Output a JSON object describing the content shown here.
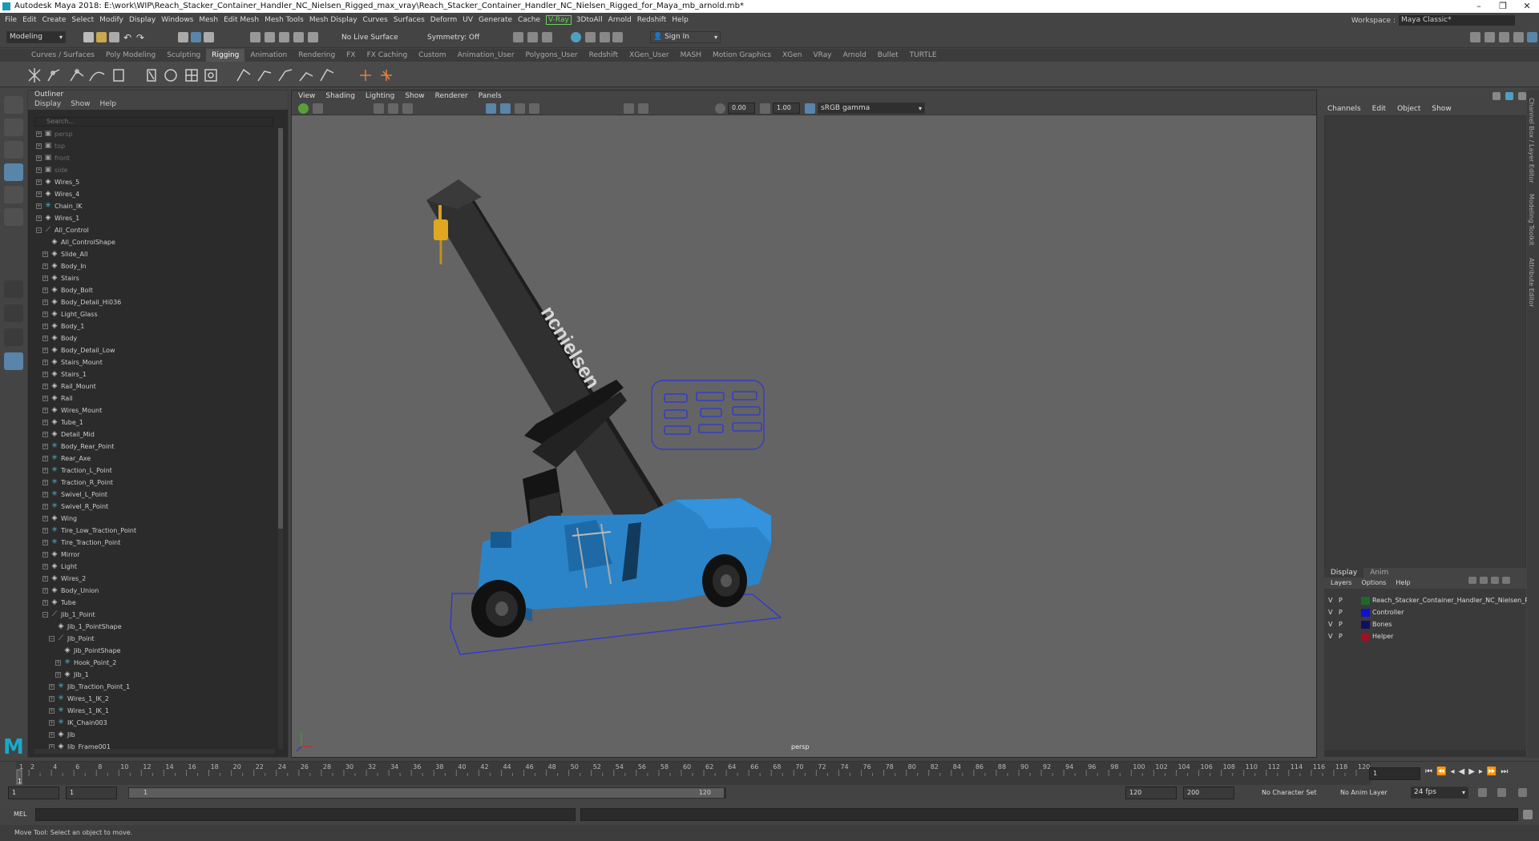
{
  "window": {
    "title": "Autodesk Maya 2018: E:\\work\\WIP\\Reach_Stacker_Container_Handler_NC_Nielsen_Rigged_max_vray\\Reach_Stacker_Container_Handler_NC_Nielsen_Rigged_for_Maya_mb_arnold.mb*",
    "controls": [
      "–",
      "❐",
      "✕"
    ]
  },
  "menubar": {
    "items": [
      "File",
      "Edit",
      "Create",
      "Select",
      "Modify",
      "Display",
      "Windows",
      "Mesh",
      "Edit Mesh",
      "Mesh Tools",
      "Mesh Display",
      "Curves",
      "Surfaces",
      "Deform",
      "UV",
      "Generate",
      "Cache"
    ],
    "vray": "V-Ray",
    "items2": [
      "3DtoAll",
      "Arnold",
      "Redshift",
      "Help"
    ],
    "workspace_label": "Workspace :",
    "workspace_value": "Maya Classic*"
  },
  "statusline": {
    "mode": "Modeling",
    "live_surface": "No Live Surface",
    "symmetry": "Symmetry: Off",
    "sign_in": "Sign In"
  },
  "shelf": {
    "tabs": [
      "Curves / Surfaces",
      "Poly Modeling",
      "Sculpting",
      "Rigging",
      "Animation",
      "Rendering",
      "FX",
      "FX Caching",
      "Custom",
      "Animation_User",
      "Polygons_User",
      "Redshift",
      "XGen_User",
      "MASH",
      "Motion Graphics",
      "XGen",
      "VRay",
      "Arnold",
      "Bullet",
      "TURTLE"
    ],
    "active": "Rigging"
  },
  "outliner": {
    "title": "Outliner",
    "menu": [
      "Display",
      "Show",
      "Help"
    ],
    "search_placeholder": "Search...",
    "items": [
      {
        "label": "persp",
        "depth": 0,
        "type": "cam",
        "dim": true
      },
      {
        "label": "top",
        "depth": 0,
        "type": "cam",
        "dim": true
      },
      {
        "label": "front",
        "depth": 0,
        "type": "cam",
        "dim": true
      },
      {
        "label": "side",
        "depth": 0,
        "type": "cam",
        "dim": true
      },
      {
        "label": "Wires_5",
        "depth": 0,
        "type": "group"
      },
      {
        "label": "Wires_4",
        "depth": 0,
        "type": "group"
      },
      {
        "label": "Chain_IK",
        "depth": 0,
        "type": "joint"
      },
      {
        "label": "Wires_1",
        "depth": 0,
        "type": "group"
      },
      {
        "label": "All_Control",
        "depth": 0,
        "type": "curve",
        "open": true
      },
      {
        "label": "All_ControlShape",
        "depth": 1,
        "type": "shape"
      },
      {
        "label": "Slide_All",
        "depth": 1,
        "type": "group"
      },
      {
        "label": "Body_In",
        "depth": 1,
        "type": "group"
      },
      {
        "label": "Stairs",
        "depth": 1,
        "type": "group"
      },
      {
        "label": "Body_Bolt",
        "depth": 1,
        "type": "group"
      },
      {
        "label": "Body_Detail_Hi036",
        "depth": 1,
        "type": "group"
      },
      {
        "label": "Light_Glass",
        "depth": 1,
        "type": "group"
      },
      {
        "label": "Body_1",
        "depth": 1,
        "type": "group"
      },
      {
        "label": "Body",
        "depth": 1,
        "type": "group"
      },
      {
        "label": "Body_Detail_Low",
        "depth": 1,
        "type": "group"
      },
      {
        "label": "Stairs_Mount",
        "depth": 1,
        "type": "group"
      },
      {
        "label": "Stairs_1",
        "depth": 1,
        "type": "group"
      },
      {
        "label": "Rail_Mount",
        "depth": 1,
        "type": "group"
      },
      {
        "label": "Rail",
        "depth": 1,
        "type": "group"
      },
      {
        "label": "Wires_Mount",
        "depth": 1,
        "type": "group"
      },
      {
        "label": "Tube_1",
        "depth": 1,
        "type": "group"
      },
      {
        "label": "Detail_Mid",
        "depth": 1,
        "type": "group"
      },
      {
        "label": "Body_Rear_Point",
        "depth": 1,
        "type": "joint"
      },
      {
        "label": "Rear_Axe",
        "depth": 1,
        "type": "joint"
      },
      {
        "label": "Traction_L_Point",
        "depth": 1,
        "type": "joint"
      },
      {
        "label": "Traction_R_Point",
        "depth": 1,
        "type": "joint"
      },
      {
        "label": "Swivel_L_Point",
        "depth": 1,
        "type": "joint"
      },
      {
        "label": "Swivel_R_Point",
        "depth": 1,
        "type": "joint"
      },
      {
        "label": "Wing",
        "depth": 1,
        "type": "group"
      },
      {
        "label": "Tire_Low_Traction_Point",
        "depth": 1,
        "type": "joint"
      },
      {
        "label": "Tire_Traction_Point",
        "depth": 1,
        "type": "joint"
      },
      {
        "label": "Mirror",
        "depth": 1,
        "type": "group"
      },
      {
        "label": "Light",
        "depth": 1,
        "type": "group"
      },
      {
        "label": "Wires_2",
        "depth": 1,
        "type": "group"
      },
      {
        "label": "Body_Union",
        "depth": 1,
        "type": "group"
      },
      {
        "label": "Tube",
        "depth": 1,
        "type": "group"
      },
      {
        "label": "Jib_1_Point",
        "depth": 1,
        "type": "curve",
        "open": true
      },
      {
        "label": "Jib_1_PointShape",
        "depth": 2,
        "type": "shape"
      },
      {
        "label": "Jib_Point",
        "depth": 2,
        "type": "curve",
        "open": true
      },
      {
        "label": "Jib_PointShape",
        "depth": 3,
        "type": "shape"
      },
      {
        "label": "Hook_Point_2",
        "depth": 3,
        "type": "joint"
      },
      {
        "label": "Jib_1",
        "depth": 3,
        "type": "group"
      },
      {
        "label": "Jib_Traction_Point_1",
        "depth": 2,
        "type": "joint"
      },
      {
        "label": "Wires_1_IK_2",
        "depth": 2,
        "type": "joint"
      },
      {
        "label": "Wires_1_IK_1",
        "depth": 2,
        "type": "joint"
      },
      {
        "label": "IK_Chain003",
        "depth": 2,
        "type": "joint"
      },
      {
        "label": "Jib",
        "depth": 2,
        "type": "group"
      },
      {
        "label": "Jib_Frame001",
        "depth": 2,
        "type": "group"
      }
    ]
  },
  "viewport": {
    "menu": [
      "View",
      "Shading",
      "Lighting",
      "Show",
      "Renderer",
      "Panels"
    ],
    "exposure": "0.00",
    "gamma": "1.00",
    "colorspace": "sRGB gamma",
    "camera": "persp",
    "brand_text": "ncnielsen"
  },
  "channelbox": {
    "menu": [
      "Channels",
      "Edit",
      "Object",
      "Show"
    ],
    "side_tabs": [
      "Channel Box / Layer Editor",
      "Modeling Toolkit",
      "Attribute Editor"
    ]
  },
  "layers": {
    "tabs": [
      "Display",
      "Anim"
    ],
    "menu": [
      "Layers",
      "Options",
      "Help"
    ],
    "rows": [
      {
        "v": "V",
        "p": "P",
        "name": "Reach_Stacker_Container_Handler_NC_Nielsen_Rigg",
        "color": "#1a6b2a"
      },
      {
        "v": "V",
        "p": "P",
        "name": "Controller",
        "color": "#1010d0"
      },
      {
        "v": "V",
        "p": "P",
        "name": "Bones",
        "color": "#101060"
      },
      {
        "v": "V",
        "p": "P",
        "name": "Helper",
        "color": "#a01020"
      }
    ]
  },
  "timeline": {
    "ticks": [
      "1",
      "2",
      "4",
      "6",
      "8",
      "10",
      "12",
      "14",
      "16",
      "18",
      "20",
      "22",
      "24",
      "26",
      "28",
      "30",
      "32",
      "34",
      "36",
      "38",
      "40",
      "42",
      "44",
      "46",
      "48",
      "50",
      "52",
      "54",
      "56",
      "58",
      "60",
      "62",
      "64",
      "66",
      "68",
      "70",
      "72",
      "74",
      "76",
      "78",
      "80",
      "82",
      "84",
      "86",
      "88",
      "90",
      "92",
      "94",
      "96",
      "98",
      "100",
      "102",
      "104",
      "106",
      "108",
      "110",
      "112",
      "114",
      "116",
      "118",
      "120"
    ],
    "current_frame": "1",
    "range_start": "1",
    "range_start2": "1",
    "range_slider_start": "1",
    "range_slider_end": "120",
    "range_end": "120",
    "range_end2": "200",
    "character_set": "No Character Set",
    "anim_layer": "No Anim Layer",
    "fps": "24 fps"
  },
  "cmdline": {
    "label": "MEL"
  },
  "helpline": {
    "text": "Move Tool: Select an object to move."
  }
}
